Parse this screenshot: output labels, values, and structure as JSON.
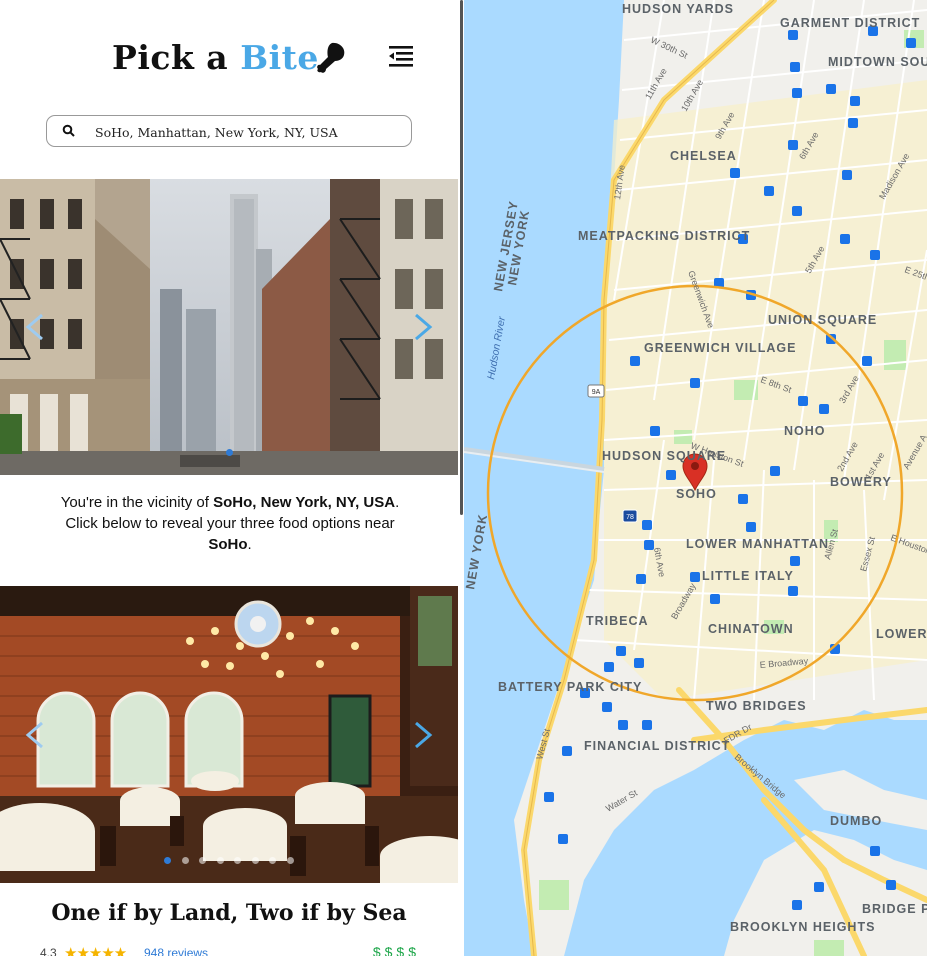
{
  "app": {
    "logo_word1": "Pick a",
    "logo_word2": "Bite",
    "menu_icon": "menu-icon"
  },
  "search": {
    "value": "SoHo, Manhattan, New York, NY, USA",
    "icon": "search-icon"
  },
  "location_text": {
    "line1_prefix": "You're in the vicinity of ",
    "line1_bold": "SoHo, New York, NY, USA",
    "line1_suffix": ".",
    "line2": "Click below to reveal your three food options near",
    "line3_bold": "SoHo",
    "line3_suffix": "."
  },
  "restaurant": {
    "name": "One if by Land, Two if by Sea",
    "rating": "4.3",
    "reviews": "948 reviews",
    "price": "$$$$"
  },
  "map": {
    "labels": {
      "hudson_yards": "HUDSON YARDS",
      "garment_district": "GARMENT DISTRICT",
      "midtown_south": "MIDTOWN SOUTH",
      "chelsea": "CHELSEA",
      "meatpacking": "MEATPACKING DISTRICT",
      "union_square": "UNION SQUARE",
      "greenwich_village": "GREENWICH VILLAGE",
      "noho": "NOHO",
      "hudson_square": "HUDSON SQUARE",
      "soho": "SOHO",
      "bowery": "BOWERY",
      "lower_manhattan": "LOWER MANHATTAN",
      "little_italy": "LITTLE ITALY",
      "tribeca": "TRIBECA",
      "chinatown": "CHINATOWN",
      "lower_east_side": "LOWER EAST SID",
      "battery_park_city": "BATTERY PARK CITY",
      "two_bridges": "TWO BRIDGES",
      "financial_district": "FINANCIAL DISTRICT",
      "dumbo": "DUMBO",
      "brooklyn_heights": "BROOKLYN HEIGHTS",
      "bridge_park": "BRIDGE P DOWNTOW BROOKLY",
      "new_jersey": "NEW JERSEY",
      "new_york_upper": "NEW YORK",
      "new_york_lower": "NEW YORK",
      "hudson_river": "Hudson River"
    },
    "streets": [
      "W 30th St",
      "11th Ave",
      "10th Ave",
      "9th Ave",
      "6th Ave",
      "12th Ave",
      "5th Ave",
      "Madison Ave",
      "Greenwich Ave",
      "E 8th St",
      "3rd Ave",
      "2nd Ave",
      "1st Ave",
      "W Houston St",
      "Avenue A",
      "E Houston St",
      "6th Ave",
      "Broadway",
      "Allen St",
      "Essex St",
      "E Broadway",
      "West St",
      "FDR Dr",
      "Brooklyn Bridge",
      "Water St",
      "E 25th St"
    ],
    "highway_shields": [
      "9A",
      "78"
    ],
    "colors": {
      "water": "#aadaff",
      "land": "#f1f0ec",
      "park": "#c3ecb2",
      "highway": "#fbd86b",
      "radius": "#f0a72a",
      "pin": "#d93025"
    }
  }
}
